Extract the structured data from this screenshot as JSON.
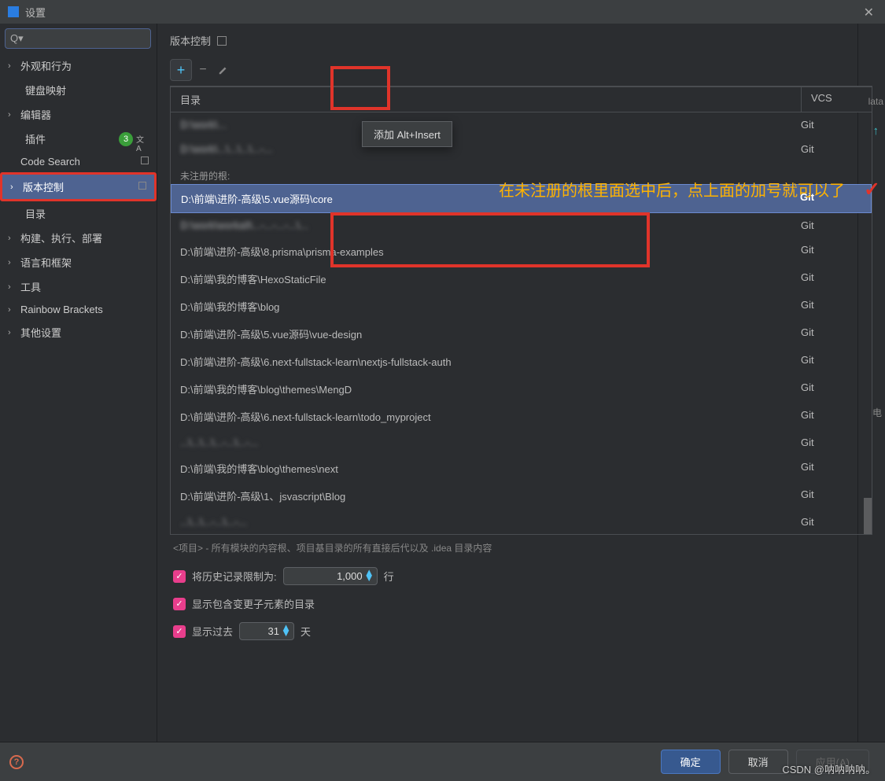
{
  "window": {
    "title": "设置"
  },
  "search": {
    "placeholder": "Q▾"
  },
  "sidebar": {
    "items": [
      {
        "label": "外观和行为",
        "expandable": true,
        "leaf": false
      },
      {
        "label": "键盘映射",
        "expandable": false,
        "leaf": true
      },
      {
        "label": "编辑器",
        "expandable": true,
        "leaf": false
      },
      {
        "label": "插件",
        "expandable": false,
        "leaf": true,
        "badge": "3",
        "icon": true
      },
      {
        "label": "Code Search",
        "expandable": false,
        "leaf": false
      },
      {
        "label": "版本控制",
        "expandable": true,
        "leaf": false,
        "selected": true,
        "highlighted": true
      },
      {
        "label": "目录",
        "expandable": false,
        "leaf": true
      },
      {
        "label": "构建、执行、部署",
        "expandable": true,
        "leaf": false
      },
      {
        "label": "语言和框架",
        "expandable": true,
        "leaf": false
      },
      {
        "label": "工具",
        "expandable": true,
        "leaf": false
      },
      {
        "label": "Rainbow Brackets",
        "expandable": true,
        "leaf": false
      },
      {
        "label": "其他设置",
        "expandable": true,
        "leaf": false
      }
    ]
  },
  "breadcrumb": "版本控制",
  "popup": {
    "text": "添加  Alt+Insert"
  },
  "annotation": "在未注册的根里面选中后，点上面的加号就可以了",
  "table": {
    "headers": {
      "dir": "目录",
      "vcs": "VCS"
    },
    "registered": [
      {
        "dir": "D:\\work\\...",
        "vcs": "Git",
        "blur": true
      },
      {
        "dir": "D:\\work\\...\\...\\...\\...-...",
        "vcs": "Git",
        "blur": true
      }
    ],
    "unreg_label": "未注册的根:",
    "unregistered": [
      {
        "dir": "D:\\前端\\进阶-高级\\5.vue源码\\core",
        "vcs": "Git",
        "selected": true
      },
      {
        "dir": "D:\\work\\workall\\...-...-...-...\\...",
        "vcs": "Git",
        "blur": true
      },
      {
        "dir": "D:\\前端\\进阶-高级\\8.prisma\\prisma-examples",
        "vcs": "Git"
      },
      {
        "dir": "D:\\前端\\我的博客\\HexoStaticFile",
        "vcs": "Git"
      },
      {
        "dir": "D:\\前端\\我的博客\\blog",
        "vcs": "Git"
      },
      {
        "dir": "D:\\前端\\进阶-高级\\5.vue源码\\vue-design",
        "vcs": "Git"
      },
      {
        "dir": "D:\\前端\\进阶-高级\\6.next-fullstack-learn\\nextjs-fullstack-auth",
        "vcs": "Git"
      },
      {
        "dir": "D:\\前端\\我的博客\\blog\\themes\\MengD",
        "vcs": "Git"
      },
      {
        "dir": "D:\\前端\\进阶-高级\\6.next-fullstack-learn\\todo_myproject",
        "vcs": "Git"
      },
      {
        "dir": "...\\...\\...\\...-...\\...-...",
        "vcs": "Git",
        "blur": true
      },
      {
        "dir": "D:\\前端\\我的博客\\blog\\themes\\next",
        "vcs": "Git"
      },
      {
        "dir": "D:\\前端\\进阶-高级\\1、jsvascript\\Blog",
        "vcs": "Git"
      },
      {
        "dir": "...\\...\\...-...\\...-...",
        "vcs": "Git",
        "blur": true
      }
    ]
  },
  "hint": "<项目> - 所有模块的内容根、项目基目录的所有直接后代以及 .idea 目录内容",
  "options": {
    "history_label": "将历史记录限制为:",
    "history_value": "1,000",
    "history_suffix": "行",
    "show_changed": "显示包含变更子元素的目录",
    "show_past_prefix": "显示过去",
    "show_past_value": "31",
    "show_past_suffix": "天"
  },
  "footer": {
    "ok": "确定",
    "cancel": "取消",
    "apply": "应用(A)"
  },
  "watermark": "CSDN @呐呐呐呐。",
  "right_text": "lata",
  "right_char": "电"
}
